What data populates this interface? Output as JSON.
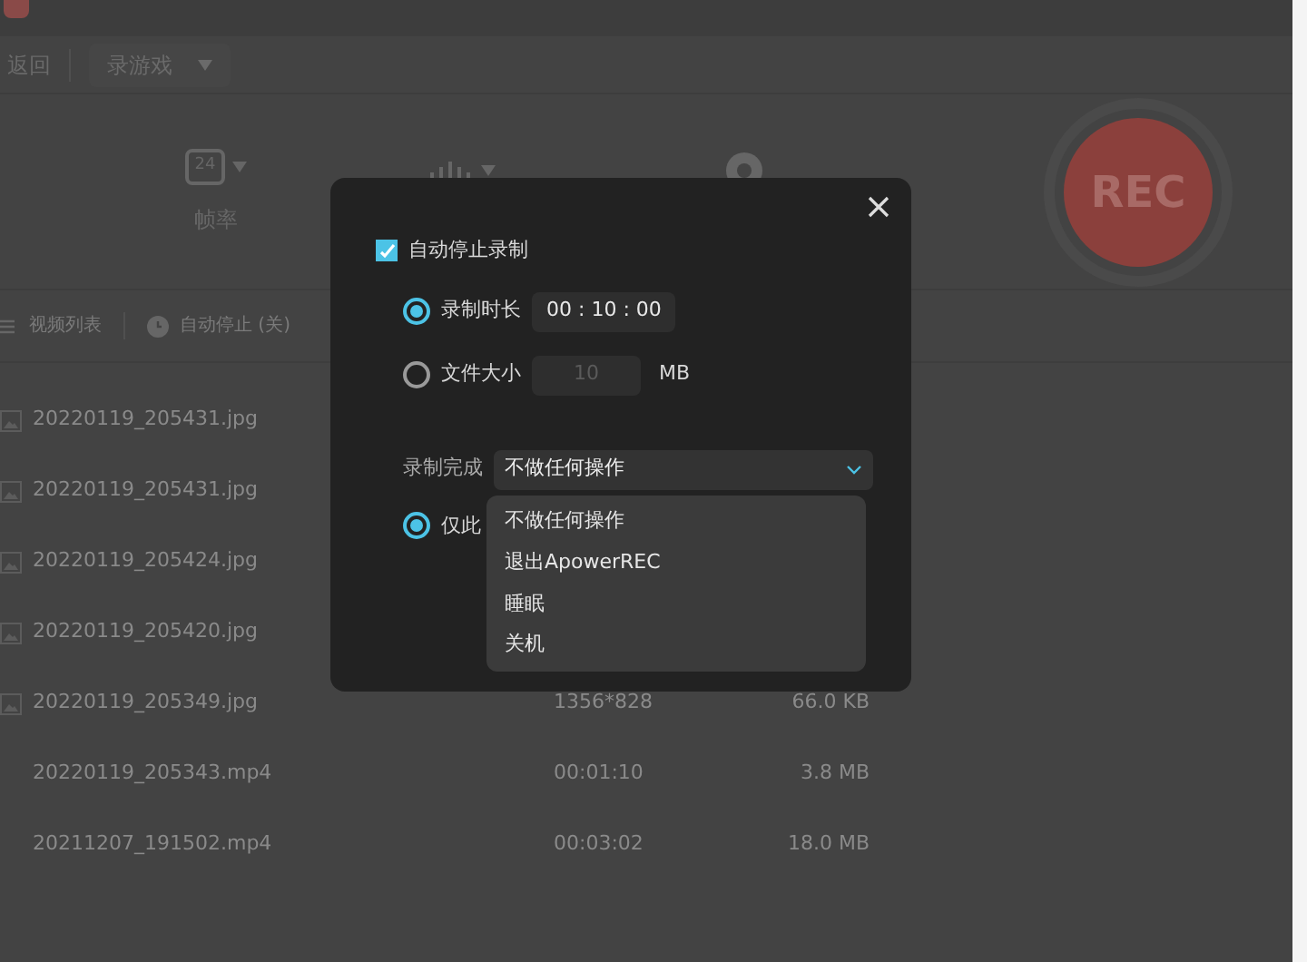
{
  "toolbar": {
    "back": "返回",
    "mode": "录游戏"
  },
  "controls": [
    {
      "kind": "frame-rate",
      "badge": "24",
      "label": "帧率"
    },
    {
      "kind": "audio"
    },
    {
      "kind": "webcam"
    }
  ],
  "rec_button": "REC",
  "list_bar": {
    "list_label": "视频列表",
    "auto_stop": "自动停止 (关)"
  },
  "files": [
    {
      "name": "20220119_205431.jpg",
      "kind": "image"
    },
    {
      "name": "20220119_205431.jpg",
      "kind": "image"
    },
    {
      "name": "20220119_205424.jpg",
      "kind": "image"
    },
    {
      "name": "20220119_205420.jpg",
      "kind": "image"
    },
    {
      "name": "20220119_205349.jpg",
      "kind": "image",
      "detail": "1356*828",
      "size": "66.0 KB"
    },
    {
      "name": "20220119_205343.mp4",
      "kind": "video",
      "detail": "00:01:10",
      "size": "3.8 MB"
    },
    {
      "name": "20211207_191502.mp4",
      "kind": "video",
      "detail": "00:03:02",
      "size": "18.0 MB"
    }
  ],
  "dialog": {
    "auto_stop": {
      "label": "自动停止录制",
      "checked": true
    },
    "options": [
      {
        "label": "录制时长",
        "selected": true,
        "value": "00 : 10 : 00"
      },
      {
        "label": "文件大小",
        "selected": false,
        "value": "10",
        "unit": "MB"
      }
    ],
    "finish_label": "录制完成",
    "finish_value": "不做任何操作",
    "menu": [
      {
        "label": "不做任何操作"
      },
      {
        "label": "退出ApowerREC"
      },
      {
        "label": "睡眠"
      },
      {
        "label": "关机"
      }
    ],
    "scope": {
      "label": "仅此",
      "selected": true
    }
  }
}
